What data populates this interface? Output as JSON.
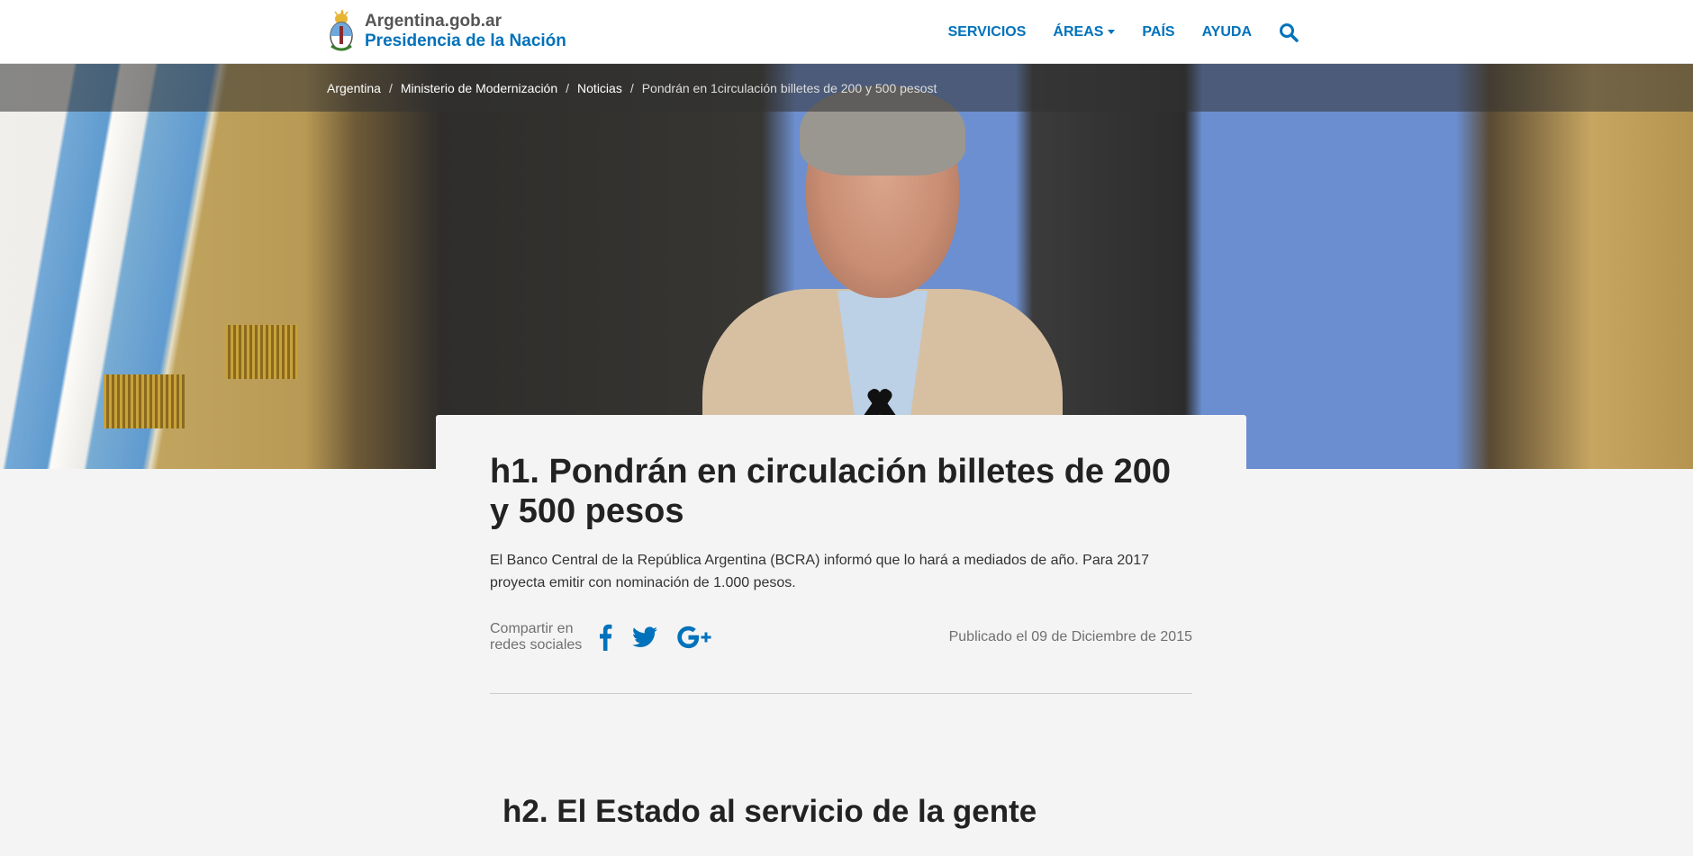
{
  "header": {
    "logo_line1": "Argentina.gob.ar",
    "logo_line2": "Presidencia de la Nación",
    "nav": {
      "servicios": "SERVICIOS",
      "areas": "ÁREAS",
      "pais": "PAÍS",
      "ayuda": "AYUDA"
    },
    "search_icon": "search-icon"
  },
  "breadcrumb": {
    "items": [
      "Argentina",
      "Ministerio de Modernización",
      "Noticias"
    ],
    "current": "Pondrán en 1circulación billetes de 200 y 500 pesost",
    "separator": "/"
  },
  "article": {
    "title": "h1. Pondrán en circulación billetes de 200 y 500 pesos",
    "lead": "El Banco Central de la República Argentina (BCRA) informó que lo hará a mediados de año. Para 2017 proyecta emitir con nominación de 1.000 pesos.",
    "share_label_1": "Compartir en",
    "share_label_2": "redes sociales",
    "share_icons": [
      "facebook-icon",
      "twitter-icon",
      "google-plus-icon"
    ],
    "published": "Publicado el 09 de Diciembre de 2015"
  },
  "section2": {
    "title": "h2. El Estado al servicio de la gente"
  },
  "colors": {
    "brand_blue": "#0072bb",
    "text_dark": "#222222",
    "text_muted": "#707070",
    "background": "#f4f4f4"
  }
}
